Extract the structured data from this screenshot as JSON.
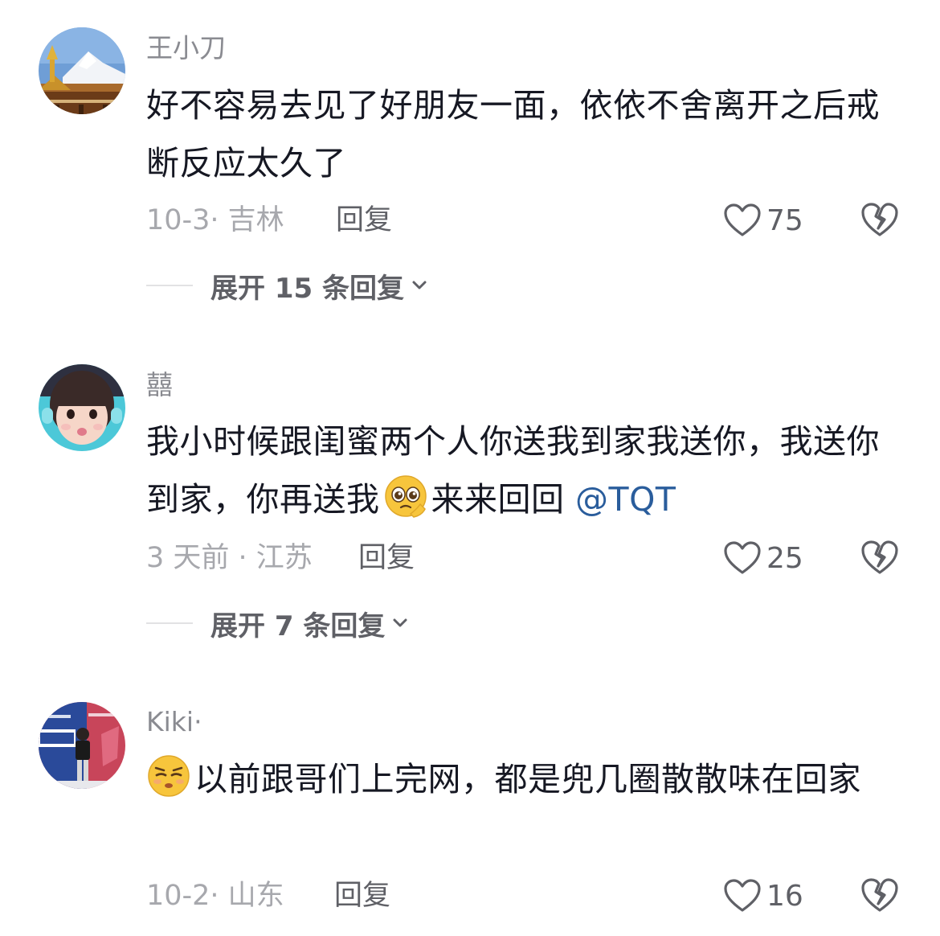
{
  "comments": [
    {
      "username": "王小刀",
      "text": "好不容易去见了好朋友一面，依依不舍离开之后戒断反应太久了",
      "meta": "10-3· 吉林",
      "reply_label": "回复",
      "likes": "75",
      "expand_label": "展开 15 条回复"
    },
    {
      "username": "囍",
      "text_before_emoji": "我小时候跟闺蜜两个人你送我到家我送你，我送你到家，你再送我",
      "emoji": "pleading-face",
      "text_after_emoji": "来来回回 ",
      "mention": "@TQT",
      "meta": "3 天前 · 江苏",
      "reply_label": "回复",
      "likes": "25",
      "expand_label": "展开 7 条回复"
    },
    {
      "username": "Kiki·",
      "emoji": "unamused-face",
      "text": "以前跟哥们上完网，都是兜几圈散散味在回家",
      "meta": "10-2· 山东",
      "reply_label": "回复",
      "likes": "16"
    }
  ],
  "icons": {
    "like": "heart-outline-icon",
    "dislike": "broken-heart-icon",
    "expand": "chevron-down-icon"
  },
  "colors": {
    "text": "#161823",
    "secondary": "#a7a8ad",
    "mention": "#2a5d9c"
  }
}
